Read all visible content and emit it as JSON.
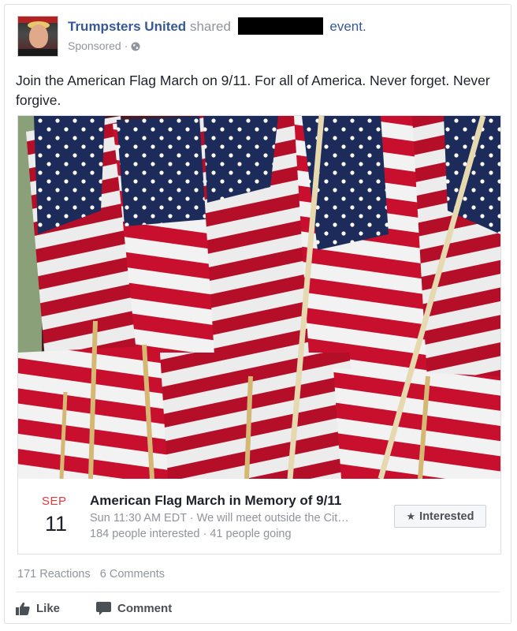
{
  "post": {
    "page_name": "Trumpsters United",
    "shared_text": "shared",
    "event_word": "event.",
    "sponsored": "Sponsored",
    "sponsored_separator": "·",
    "body_text": "Join the American Flag March on 9/11. For all of America. Never forget. Never forgive."
  },
  "event": {
    "month": "SEP",
    "day": "11",
    "title": "American Flag March in Memory of 9/11",
    "time_line": "Sun 11:30 AM EDT · We will meet outside the Cit…",
    "stats": "184 people interested · 41 people going",
    "interested_label": "Interested"
  },
  "footer": {
    "reactions": "171 Reactions",
    "comments": "6 Comments",
    "like_label": "Like",
    "comment_label": "Comment"
  },
  "colors": {
    "link_blue": "#365899",
    "muted_gray": "#90949c",
    "date_red": "#e0393e",
    "flag_red": "#c8102e",
    "flag_blue": "#1c2b5a",
    "icon_gray": "#4b4f56"
  },
  "icons": {
    "privacy": "globe-icon",
    "interested": "star-icon",
    "like": "thumbs-up-icon",
    "comment": "comment-bubble-icon"
  }
}
